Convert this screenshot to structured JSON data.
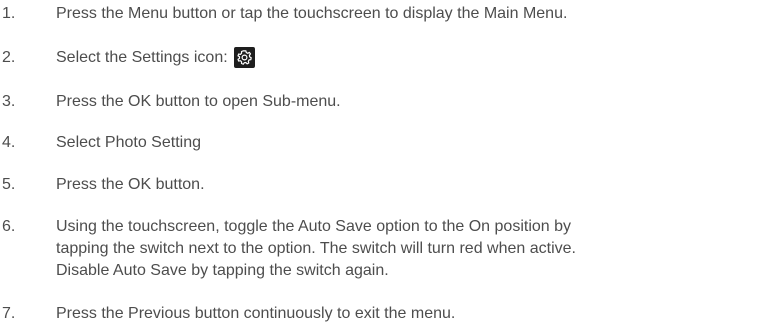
{
  "steps": [
    {
      "number": "1.",
      "lines": [
        "Press the Menu button or tap the touchscreen to display the Main Menu."
      ]
    },
    {
      "number": "2.",
      "lines": [
        "Select the Settings icon:"
      ],
      "icon": "settings-gear-icon"
    },
    {
      "number": "3.",
      "lines": [
        "Press the OK button to open Sub-menu."
      ]
    },
    {
      "number": "4.",
      "lines": [
        "Select Photo Setting"
      ]
    },
    {
      "number": "5.",
      "lines": [
        "Press the OK button."
      ]
    },
    {
      "number": "6.",
      "lines": [
        "Using the touchscreen, toggle the Auto Save option to the On position by",
        "tapping the switch next to the option. The switch will turn red when active.",
        "Disable Auto Save by tapping the switch again."
      ]
    },
    {
      "number": "7.",
      "lines": [
        "Press the Previous button continuously to exit the menu."
      ]
    }
  ]
}
